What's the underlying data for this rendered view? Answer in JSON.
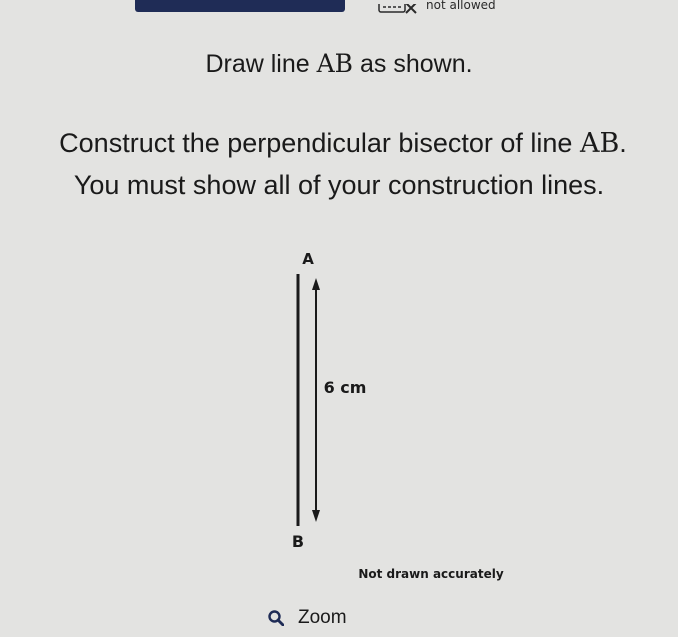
{
  "header": {
    "badge_label": "not allowed"
  },
  "question": {
    "line1": {
      "before": "Draw line ",
      "math": "AB",
      "after": " as shown."
    },
    "line2": {
      "before": "Construct the perpendicular bisector of line ",
      "math": "AB",
      "after": "."
    },
    "line3": "You must show all of your construction lines."
  },
  "diagram": {
    "label_a": "A",
    "label_b": "B",
    "length_label": "6 cm",
    "note": "Not drawn accurately"
  },
  "zoom": {
    "label": "Zoom",
    "icon": "magnifier-icon",
    "icon_color": "#1f2c56"
  }
}
